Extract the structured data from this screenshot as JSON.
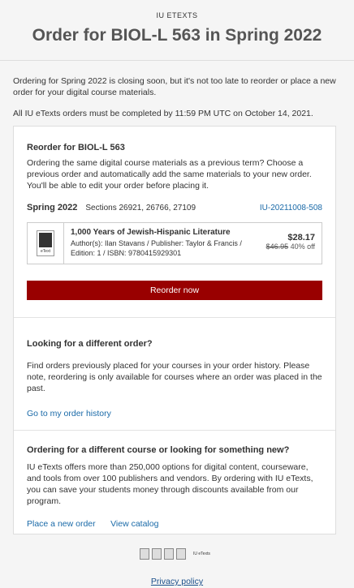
{
  "header": {
    "eyebrow": "IU ETEXTS",
    "title": "Order for BIOL-L 563 in Spring 2022"
  },
  "intro": {
    "closing_notice": "Ordering for Spring 2022 is closing soon, but it's not too late to reorder or place a new order for your digital course materials.",
    "deadline_notice": "All IU eTexts orders must be completed by 11:59 PM UTC on October 14, 2021."
  },
  "reorder": {
    "heading": "Reorder for BIOL-L 563",
    "description": "Ordering the same digital course materials as a previous term? Choose a previous order and automatically add the same materials to your new order. You'll be able to edit your order before placing it.",
    "term": "Spring 2022",
    "sections": "Sections 26921, 26766, 27109",
    "order_id": "IU-20211008-508",
    "book": {
      "thumb_label": "eText",
      "title": "1,000 Years of Jewish-Hispanic Literature",
      "meta": "Author(s): Ilan Stavans / Publisher: Taylor & Francis / Edition: 1 / ISBN: 9780415929301",
      "price": "$28.17",
      "original_price": "$46.95",
      "discount": "40% off"
    },
    "button_label": "Reorder now"
  },
  "different_order": {
    "heading": "Looking for a different order?",
    "description": "Find orders previously placed for your courses in your order history. Please note, reordering is only available for courses where an order was placed in the past.",
    "link": "Go to my order history"
  },
  "new_course": {
    "heading": "Ordering for a different course or looking for something new?",
    "description": "IU eTexts offers more than 250,000 options for digital content, courseware, and tools from over 100 publishers and vendors. By ordering with IU eTexts, you can save your students money through discounts available from our program.",
    "link_new_order": "Place a new order",
    "link_catalog": "View catalog"
  },
  "footer": {
    "logo_text": "IU eTexts",
    "privacy": "Privacy policy"
  },
  "colors": {
    "primary_button": "#990000",
    "link": "#1a6aa8"
  }
}
